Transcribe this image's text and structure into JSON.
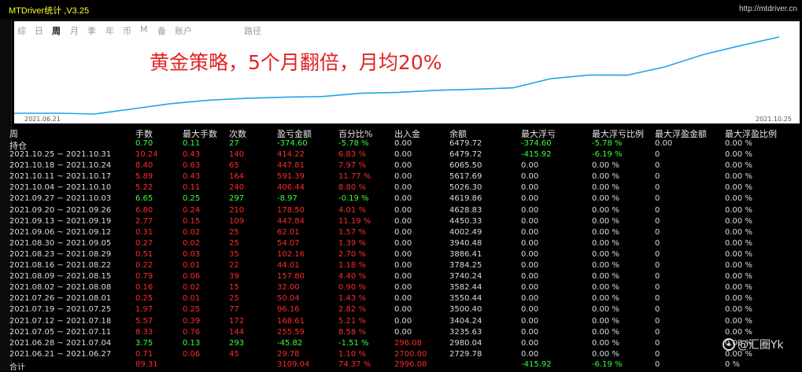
{
  "window": {
    "title": "MTDriver统计 ,V3.25",
    "url": "http://mtdriver.cn"
  },
  "tabs": [
    {
      "label": "综",
      "active": false
    },
    {
      "label": "日",
      "active": false
    },
    {
      "label": "周",
      "active": true
    },
    {
      "label": "月",
      "active": false
    },
    {
      "label": "季",
      "active": false
    },
    {
      "label": "年",
      "active": false
    },
    {
      "label": "币",
      "active": false
    },
    {
      "label": "M",
      "active": false
    },
    {
      "label": "备",
      "active": false
    },
    {
      "label": "账户",
      "active": false
    },
    {
      "label": "路径",
      "active": false
    }
  ],
  "chart": {
    "banner": "黄金策略，5个月翻倍，月均20%",
    "start_date": "2021.06.21",
    "end_date": "2021.10.25",
    "line_color": "#1ea4e8",
    "balance_series": [
      2729.78,
      2980.04,
      3235.63,
      3404.24,
      3500.4,
      3550.44,
      3582.44,
      3740.24,
      3784.25,
      3886.41,
      3940.48,
      4002.49,
      4450.33,
      4628.83,
      4619.86,
      5026.3,
      5617.69,
      6065.5,
      6479.72
    ]
  },
  "table": {
    "headers": [
      "周",
      "手数",
      "最大手数",
      "次数",
      "盈亏金额",
      "百分比%",
      "出入金",
      "余额",
      "最大浮亏",
      "最大浮亏比例",
      "最大浮盈金额",
      "最大浮盈比例"
    ],
    "position_row": {
      "label": "持仓",
      "lots": "0.70",
      "max_lots": "0.11",
      "count": "27",
      "pnl": "-374.60",
      "pct": "-5.78 %",
      "deposit": "0.00",
      "balance": "6479.72",
      "max_dd": "-374.60",
      "max_dd_pct": "-5.78 %",
      "max_fp": "0.00",
      "max_fp_pct": "0.00 %"
    },
    "rows": [
      {
        "period": "2021.10.25 ~ 2021.10.31",
        "lots": "10.24",
        "max_lots": "0.43",
        "count": "140",
        "pnl": "414.22",
        "pct": "6.83 %",
        "deposit": "0.00",
        "balance": "6479.72",
        "max_dd": "-415.92",
        "max_dd_pct": "-6.19 %",
        "max_fp": "0",
        "max_fp_pct": "0.00 %",
        "color": "red",
        "dd_color": "green"
      },
      {
        "period": "2021.10.18 ~ 2021.10.24",
        "lots": "8.40",
        "max_lots": "0.63",
        "count": "65",
        "pnl": "447.81",
        "pct": "7.97 %",
        "deposit": "0.00",
        "balance": "6065.50",
        "max_dd": "0.00",
        "max_dd_pct": "0.00 %",
        "max_fp": "0",
        "max_fp_pct": "0.00 %",
        "color": "red",
        "dd_color": "white"
      },
      {
        "period": "2021.10.11 ~ 2021.10.17",
        "lots": "5.89",
        "max_lots": "0.43",
        "count": "164",
        "pnl": "591.39",
        "pct": "11.77 %",
        "deposit": "0.00",
        "balance": "5617.69",
        "max_dd": "0.00",
        "max_dd_pct": "0.00 %",
        "max_fp": "0",
        "max_fp_pct": "0.00 %",
        "color": "red",
        "dd_color": "white"
      },
      {
        "period": "2021.10.04 ~ 2021.10.10",
        "lots": "5.22",
        "max_lots": "0.11",
        "count": "240",
        "pnl": "406.44",
        "pct": "8.80 %",
        "deposit": "0.00",
        "balance": "5026.30",
        "max_dd": "0.00",
        "max_dd_pct": "0.00 %",
        "max_fp": "0",
        "max_fp_pct": "0.00 %",
        "color": "red",
        "dd_color": "white"
      },
      {
        "period": "2021.09.27 ~ 2021.10.03",
        "lots": "6.65",
        "max_lots": "0.25",
        "count": "297",
        "pnl": "-8.97",
        "pct": "-0.19 %",
        "deposit": "0.00",
        "balance": "4619.86",
        "max_dd": "0.00",
        "max_dd_pct": "0.00 %",
        "max_fp": "0",
        "max_fp_pct": "0.00 %",
        "color": "green",
        "dd_color": "white"
      },
      {
        "period": "2021.09.20 ~ 2021.09.26",
        "lots": "6.80",
        "max_lots": "0.24",
        "count": "210",
        "pnl": "178.50",
        "pct": "4.01 %",
        "deposit": "0.00",
        "balance": "4628.83",
        "max_dd": "0.00",
        "max_dd_pct": "0.00 %",
        "max_fp": "0",
        "max_fp_pct": "0.00 %",
        "color": "red",
        "dd_color": "white"
      },
      {
        "period": "2021.09.13 ~ 2021.09.19",
        "lots": "2.77",
        "max_lots": "0.15",
        "count": "109",
        "pnl": "447.84",
        "pct": "11.19 %",
        "deposit": "0.00",
        "balance": "4450.33",
        "max_dd": "0.00",
        "max_dd_pct": "0.00 %",
        "max_fp": "0",
        "max_fp_pct": "0.00 %",
        "color": "red",
        "dd_color": "white"
      },
      {
        "period": "2021.09.06 ~ 2021.09.12",
        "lots": "0.31",
        "max_lots": "0.02",
        "count": "25",
        "pnl": "62.01",
        "pct": "1.57 %",
        "deposit": "0.00",
        "balance": "4002.49",
        "max_dd": "0.00",
        "max_dd_pct": "0.00 %",
        "max_fp": "0",
        "max_fp_pct": "0.00 %",
        "color": "red",
        "dd_color": "white"
      },
      {
        "period": "2021.08.30 ~ 2021.09.05",
        "lots": "0.27",
        "max_lots": "0.02",
        "count": "25",
        "pnl": "54.07",
        "pct": "1.39 %",
        "deposit": "0.00",
        "balance": "3940.48",
        "max_dd": "0.00",
        "max_dd_pct": "0.00 %",
        "max_fp": "0",
        "max_fp_pct": "0.00 %",
        "color": "red",
        "dd_color": "white"
      },
      {
        "period": "2021.08.23 ~ 2021.08.29",
        "lots": "0.51",
        "max_lots": "0.03",
        "count": "35",
        "pnl": "102.16",
        "pct": "2.70 %",
        "deposit": "0.00",
        "balance": "3886.41",
        "max_dd": "0.00",
        "max_dd_pct": "0.00 %",
        "max_fp": "0",
        "max_fp_pct": "0.00 %",
        "color": "red",
        "dd_color": "white"
      },
      {
        "period": "2021.08.16 ~ 2021.08.22",
        "lots": "0.22",
        "max_lots": "0.01",
        "count": "22",
        "pnl": "44.01",
        "pct": "1.18 %",
        "deposit": "0.00",
        "balance": "3784.25",
        "max_dd": "0.00",
        "max_dd_pct": "0.00 %",
        "max_fp": "0",
        "max_fp_pct": "0.00 %",
        "color": "red",
        "dd_color": "white"
      },
      {
        "period": "2021.08.09 ~ 2021.08.15",
        "lots": "0.79",
        "max_lots": "0.06",
        "count": "39",
        "pnl": "157.80",
        "pct": "4.40 %",
        "deposit": "0.00",
        "balance": "3740.24",
        "max_dd": "0.00",
        "max_dd_pct": "0.00 %",
        "max_fp": "0",
        "max_fp_pct": "0.00 %",
        "color": "red",
        "dd_color": "white"
      },
      {
        "period": "2021.08.02 ~ 2021.08.08",
        "lots": "0.16",
        "max_lots": "0.02",
        "count": "15",
        "pnl": "32.00",
        "pct": "0.90 %",
        "deposit": "0.00",
        "balance": "3582.44",
        "max_dd": "0.00",
        "max_dd_pct": "0.00 %",
        "max_fp": "0",
        "max_fp_pct": "0.00 %",
        "color": "red",
        "dd_color": "white"
      },
      {
        "period": "2021.07.26 ~ 2021.08.01",
        "lots": "0.25",
        "max_lots": "0.01",
        "count": "25",
        "pnl": "50.04",
        "pct": "1.43 %",
        "deposit": "0.00",
        "balance": "3550.44",
        "max_dd": "0.00",
        "max_dd_pct": "0.00 %",
        "max_fp": "0",
        "max_fp_pct": "0.00 %",
        "color": "red",
        "dd_color": "white"
      },
      {
        "period": "2021.07.19 ~ 2021.07.25",
        "lots": "1.97",
        "max_lots": "0.25",
        "count": "77",
        "pnl": "96.16",
        "pct": "2.82 %",
        "deposit": "0.00",
        "balance": "3500.40",
        "max_dd": "0.00",
        "max_dd_pct": "0.00 %",
        "max_fp": "0",
        "max_fp_pct": "0.00 %",
        "color": "red",
        "dd_color": "white"
      },
      {
        "period": "2021.07.12 ~ 2021.07.18",
        "lots": "5.57",
        "max_lots": "0.39",
        "count": "172",
        "pnl": "168.61",
        "pct": "5.21 %",
        "deposit": "0.00",
        "balance": "3404.24",
        "max_dd": "0.00",
        "max_dd_pct": "0.00 %",
        "max_fp": "0",
        "max_fp_pct": "0.00 %",
        "color": "red",
        "dd_color": "white"
      },
      {
        "period": "2021.07.05 ~ 2021.07.11",
        "lots": "8.33",
        "max_lots": "0.76",
        "count": "144",
        "pnl": "255.59",
        "pct": "8.58 %",
        "deposit": "0.00",
        "balance": "3235.63",
        "max_dd": "0.00",
        "max_dd_pct": "0.00 %",
        "max_fp": "0",
        "max_fp_pct": "0.00 %",
        "color": "red",
        "dd_color": "white"
      },
      {
        "period": "2021.06.28 ~ 2021.07.04",
        "lots": "3.75",
        "max_lots": "0.13",
        "count": "293",
        "pnl": "-45.82",
        "pct": "-1.51 %",
        "deposit": "296.08",
        "balance": "2980.04",
        "max_dd": "0.00",
        "max_dd_pct": "0.00 %",
        "max_fp": "0",
        "max_fp_pct": "0.00 %",
        "color": "green",
        "dd_color": "white",
        "deposit_color": "red"
      },
      {
        "period": "2021.06.21 ~ 2021.06.27",
        "lots": "0.71",
        "max_lots": "0.06",
        "count": "45",
        "pnl": "29.78",
        "pct": "1.10 %",
        "deposit": "2700.00",
        "balance": "2729.78",
        "max_dd": "0.00",
        "max_dd_pct": "0.00 %",
        "max_fp": "0",
        "max_fp_pct": "0.00 %",
        "color": "red",
        "dd_color": "white",
        "deposit_color": "red"
      }
    ],
    "total_row": {
      "label": "合计",
      "lots": "89.31",
      "pnl": "3109.04",
      "pct": "74.37 %",
      "deposit": "2996.08",
      "max_dd": "-415.92",
      "max_dd_pct": "-6.19 %",
      "max_fp": "0",
      "max_fp_pct": "0 %"
    }
  },
  "watermark": {
    "text": "@汇圈Yk",
    "icon": "sina-weibo-icon"
  },
  "colors": {
    "profit": "#ff2a2a",
    "loss": "#39ff39",
    "neutral": "#dcdcdc",
    "title": "#ffff30"
  }
}
